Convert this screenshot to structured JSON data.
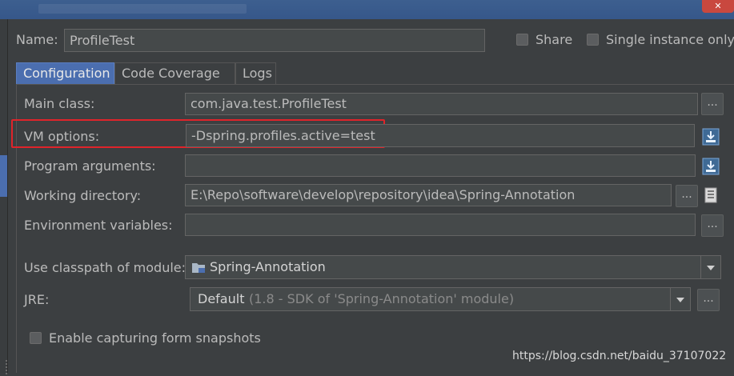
{
  "header": {
    "name_label": "Name:",
    "name_value": "ProfileTest",
    "share_label": "Share",
    "single_instance_label": "Single instance only"
  },
  "tabs": [
    {
      "label": "Configuration",
      "active": true
    },
    {
      "label": "Code Coverage",
      "active": false
    },
    {
      "label": "Logs",
      "active": false
    }
  ],
  "form": {
    "main_class": {
      "label": "Main class:",
      "value": "com.java.test.ProfileTest"
    },
    "vm_options": {
      "label": "VM options:",
      "value": "-Dspring.profiles.active=test"
    },
    "program_arguments": {
      "label": "Program arguments:",
      "value": ""
    },
    "working_directory": {
      "label": "Working directory:",
      "value": "E:\\Repo\\software\\develop\\repository\\idea\\Spring-Annotation"
    },
    "environment_variables": {
      "label": "Environment variables:",
      "value": ""
    },
    "classpath_module": {
      "label": "Use classpath of module:",
      "value": "Spring-Annotation"
    },
    "jre": {
      "label": "JRE:",
      "value": "Default",
      "detail": "(1.8 - SDK of 'Spring-Annotation' module)"
    },
    "snapshots": {
      "label": "Enable capturing form snapshots",
      "checked": false
    }
  },
  "buttons": {
    "ellipsis": "..."
  },
  "watermark": "https://blog.csdn.net/baidu_37107022",
  "colors": {
    "highlight": "#e0242a",
    "active_tab": "#4b6eaf",
    "background": "#3c3f41"
  }
}
